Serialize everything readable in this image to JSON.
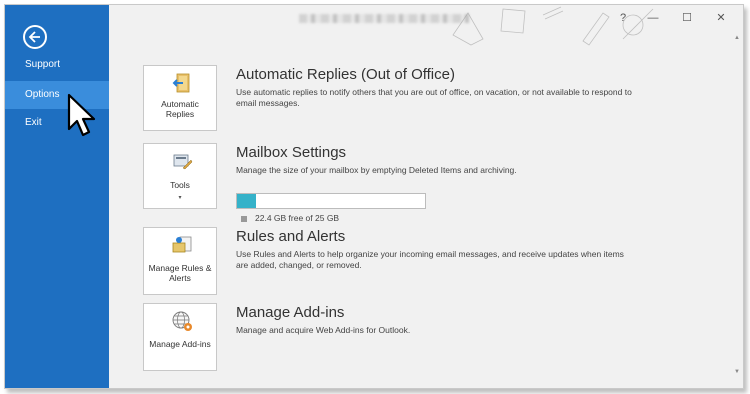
{
  "colors": {
    "sidebar": "#1e6fc1",
    "sidebar_selected": "#3a8ddc",
    "progress_fill": "#35b2c9"
  },
  "sidebar": {
    "items": [
      {
        "label": "Support"
      },
      {
        "label": "Options"
      },
      {
        "label": "Exit"
      }
    ]
  },
  "window_controls": {
    "help": "?",
    "minimize": "—",
    "maximize": "☐",
    "close": "✕"
  },
  "sections": [
    {
      "tile_label": "Automatic Replies",
      "icon": "auto-reply-icon",
      "title": "Automatic Replies (Out of Office)",
      "description": "Use automatic replies to notify others that you are out of office, on vacation, or not available to respond to email messages."
    },
    {
      "tile_label": "Tools",
      "icon": "tools-icon",
      "title": "Mailbox Settings",
      "description": "Manage the size of your mailbox by emptying Deleted Items and archiving.",
      "storage_used_fraction": 0.1,
      "storage_text": "22.4 GB free of 25 GB"
    },
    {
      "tile_label": "Manage Rules & Alerts",
      "icon": "rules-alerts-icon",
      "title": "Rules and Alerts",
      "description": "Use Rules and Alerts to help organize your incoming email messages, and receive updates when items are added, changed, or removed."
    },
    {
      "tile_label": "Manage Add-ins",
      "icon": "addins-icon",
      "title": "Manage Add-ins",
      "description": "Manage and acquire Web Add-ins for Outlook."
    }
  ]
}
